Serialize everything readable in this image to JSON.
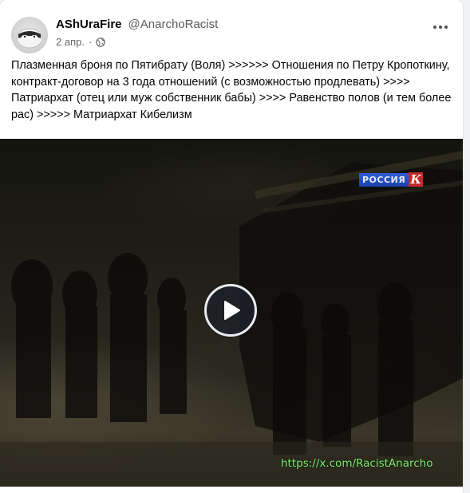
{
  "post": {
    "author": {
      "display_name": "AShUraFire",
      "handle": "@AnarchoRacist",
      "avatar_icon": "masked-face-avatar"
    },
    "date": "2 апр.",
    "separator": "·",
    "audience_icon": "globe-icon",
    "more_icon": "more-horizontal-icon",
    "text": "Плазменная броня по Пятибрату (Воля) >>>>>> Отношения по Петру Кропоткину, контракт-договор на 3 года отношений (с возможностью продлевать) >>>> Патриархат (отец или муж собственник бабы) >>>> Равенство полов (и тем более рас) >>>>> Матриархат Кибелизм",
    "video": {
      "channel_logo_text": "РОССИЯ",
      "channel_logo_mark": "К",
      "play_icon": "play-icon",
      "watermark": "https://x.com/RacistAnarcho"
    }
  },
  "colors": {
    "card_bg": "#ffffff",
    "page_bg": "#f0f2f5",
    "text_primary": "#050505",
    "text_secondary": "#65676b",
    "watermark_green": "#7cf06f",
    "logo_blue": "#2f5fd8",
    "logo_red": "#c42a2a"
  }
}
